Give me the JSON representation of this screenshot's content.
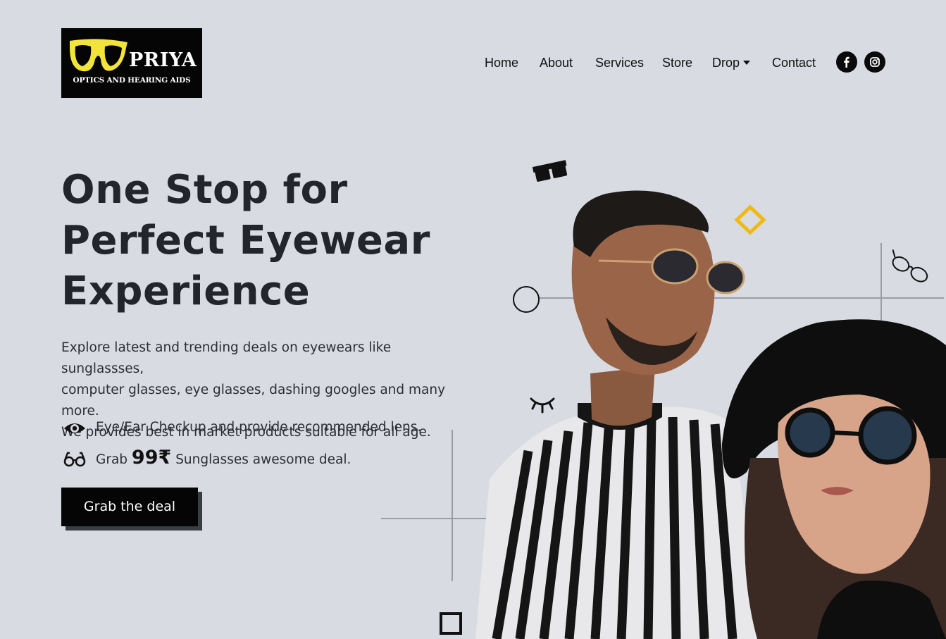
{
  "logo": {
    "brand": "PRIYA",
    "tagline": "OPTICS AND HEARING AIDS",
    "frame_color": "#f2e43a"
  },
  "nav": {
    "items": [
      {
        "label": "Home"
      },
      {
        "label": "About"
      },
      {
        "label": "Services"
      },
      {
        "label": "Store"
      },
      {
        "label": "Drop"
      },
      {
        "label": "Contact"
      }
    ],
    "social": [
      "facebook-icon",
      "instagram-icon"
    ]
  },
  "hero": {
    "headline_lines": [
      "One Stop for",
      "Perfect Eyewear",
      "Experience"
    ],
    "description_lines": [
      "Explore latest and trending deals on eyewears like sunglassses,",
      "computer glasses, eye glasses, dashing googles and many more.",
      "We provides best in market products suitable for all age."
    ],
    "feature_checkup": "Eye/Ear Checkup and provide recommended lens.",
    "feature_deal_prefix": "Grab",
    "feature_deal_price": "99₹",
    "feature_deal_suffix": "Sunglasses awesome deal.",
    "cta_label": "Grab the deal"
  },
  "colors": {
    "background": "#d8dbe2",
    "accent": "#f0b912",
    "dark": "#050505"
  }
}
